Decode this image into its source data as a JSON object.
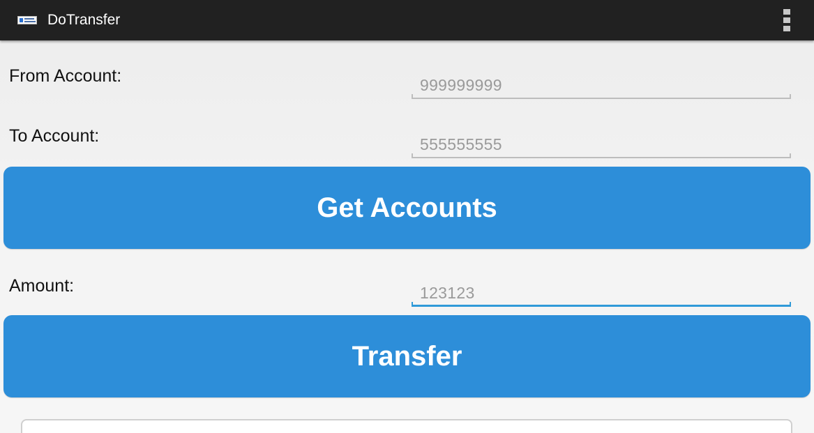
{
  "actionbar": {
    "title": "DoTransfer",
    "icon": "app-logo-icon",
    "menu_icon": "overflow-menu-icon"
  },
  "form": {
    "from_label": "From Account:",
    "from_value": "999999999",
    "to_label": "To Account:",
    "to_value": "555555555",
    "get_accounts_label": "Get Accounts",
    "amount_label": "Amount:",
    "amount_value": "123123",
    "transfer_label": "Transfer"
  },
  "colors": {
    "actionbar": "#212121",
    "button": "#2d8ed9",
    "focus_underline": "#2f9ad8"
  }
}
